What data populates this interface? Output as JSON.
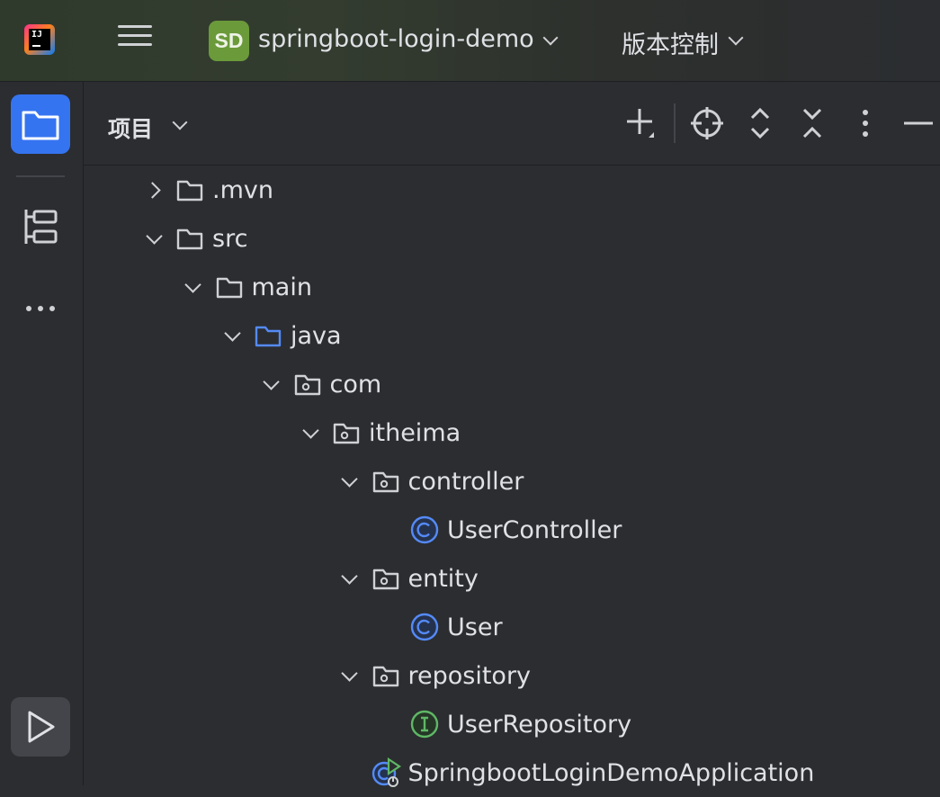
{
  "titlebar": {
    "project_badge": "SD",
    "project_name": "springboot-login-demo",
    "vcs_label": "版本控制"
  },
  "panel": {
    "title": "项目",
    "tools": [
      "add-icon",
      "locate-icon",
      "expand-all-icon",
      "collapse-all-icon",
      "more-icon",
      "minimize-icon"
    ]
  },
  "tree": [
    {
      "label": ".mvn",
      "icon": "folder-icon",
      "arrow": "right",
      "level": 0
    },
    {
      "label": "src",
      "icon": "folder-icon",
      "arrow": "down",
      "level": 0
    },
    {
      "label": "main",
      "icon": "folder-icon",
      "arrow": "down",
      "level": 1
    },
    {
      "label": "java",
      "icon": "source-folder-icon",
      "arrow": "down",
      "level": 2
    },
    {
      "label": "com",
      "icon": "package-icon",
      "arrow": "down",
      "level": 3
    },
    {
      "label": "itheima",
      "icon": "package-icon",
      "arrow": "down",
      "level": 4
    },
    {
      "label": "controller",
      "icon": "package-icon",
      "arrow": "down",
      "level": 5
    },
    {
      "label": "UserController",
      "icon": "class-icon",
      "arrow": "none",
      "level": 6
    },
    {
      "label": "entity",
      "icon": "package-icon",
      "arrow": "down",
      "level": 5
    },
    {
      "label": "User",
      "icon": "class-icon",
      "arrow": "none",
      "level": 6
    },
    {
      "label": "repository",
      "icon": "package-icon",
      "arrow": "down",
      "level": 5
    },
    {
      "label": "UserRepository",
      "icon": "interface-icon",
      "arrow": "none",
      "level": 6
    },
    {
      "label": "SpringbootLoginDemoApplication",
      "icon": "spring-boot-class-icon",
      "arrow": "none",
      "level": 5
    }
  ],
  "colors": {
    "accent": "#3574f0",
    "class_icon": "#548af7",
    "interface_icon": "#5fb865",
    "project_badge": "#6b9a3b"
  }
}
